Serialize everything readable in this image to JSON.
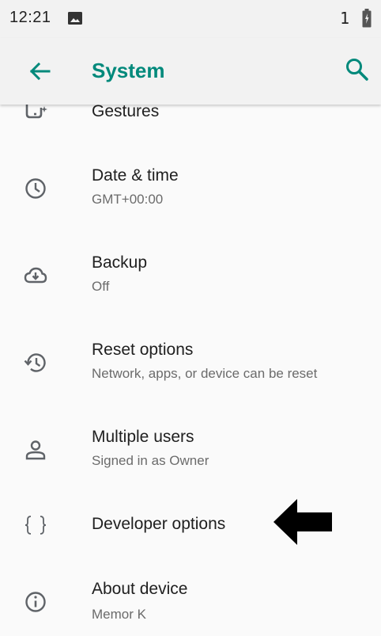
{
  "status_bar": {
    "time": "12:21",
    "count": "1",
    "image_icon": "image-icon",
    "battery_icon": "battery-icon"
  },
  "app_bar": {
    "title": "System",
    "back_icon": "arrow-back-icon",
    "search_icon": "search-icon",
    "accent_color": "#00897b"
  },
  "items": [
    {
      "title": "Gestures",
      "subtitle": "",
      "icon": "gestures-icon"
    },
    {
      "title": "Date & time",
      "subtitle": "GMT+00:00",
      "icon": "clock-icon"
    },
    {
      "title": "Backup",
      "subtitle": "Off",
      "icon": "cloud-backup-icon"
    },
    {
      "title": "Reset options",
      "subtitle": "Network, apps, or device can be reset",
      "icon": "history-icon"
    },
    {
      "title": "Multiple users",
      "subtitle": "Signed in as Owner",
      "icon": "person-icon"
    },
    {
      "title": "Developer options",
      "subtitle": "",
      "icon": "braces-icon"
    },
    {
      "title": "About device",
      "subtitle": "Memor K",
      "icon": "info-icon"
    }
  ],
  "annotation": {
    "icon": "left-arrow-pointer-icon",
    "color": "#000000"
  }
}
